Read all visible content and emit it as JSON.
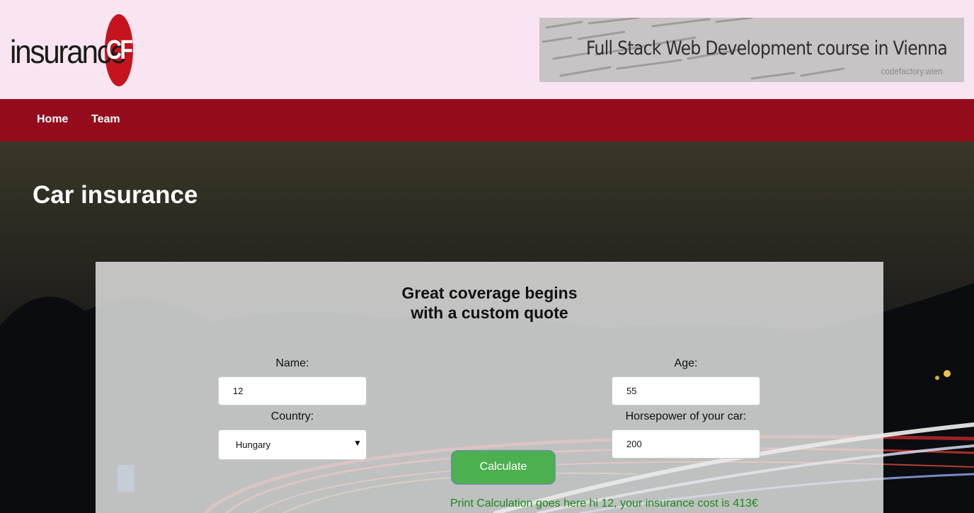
{
  "header": {
    "logo": {
      "text": "insurance",
      "badge": "CF"
    },
    "banner": {
      "title": "Full Stack Web Development course in Vienna",
      "subtitle": "codefactory.wien"
    }
  },
  "nav": {
    "items": [
      {
        "label": "Home"
      },
      {
        "label": "Team"
      }
    ]
  },
  "hero": {
    "title": "Car insurance"
  },
  "form": {
    "heading_line1": "Great coverage begins",
    "heading_line2": "with a custom quote",
    "name": {
      "label": "Name:",
      "value": "12"
    },
    "age": {
      "label": "Age:",
      "value": "55"
    },
    "country": {
      "label": "Country:",
      "selected": "Hungary"
    },
    "horsepower": {
      "label": "Horsepower of your car:",
      "value": "200"
    },
    "calculate_label": "Calculate",
    "result_text": "Print Calculation goes here hi 12, your insurance cost is 413€"
  },
  "colors": {
    "header_bg": "#f9e5f1",
    "nav_bg": "#940b1c",
    "logo_red": "#c5141e",
    "button_green": "#4caf50",
    "result_green": "#1a8a1a"
  }
}
